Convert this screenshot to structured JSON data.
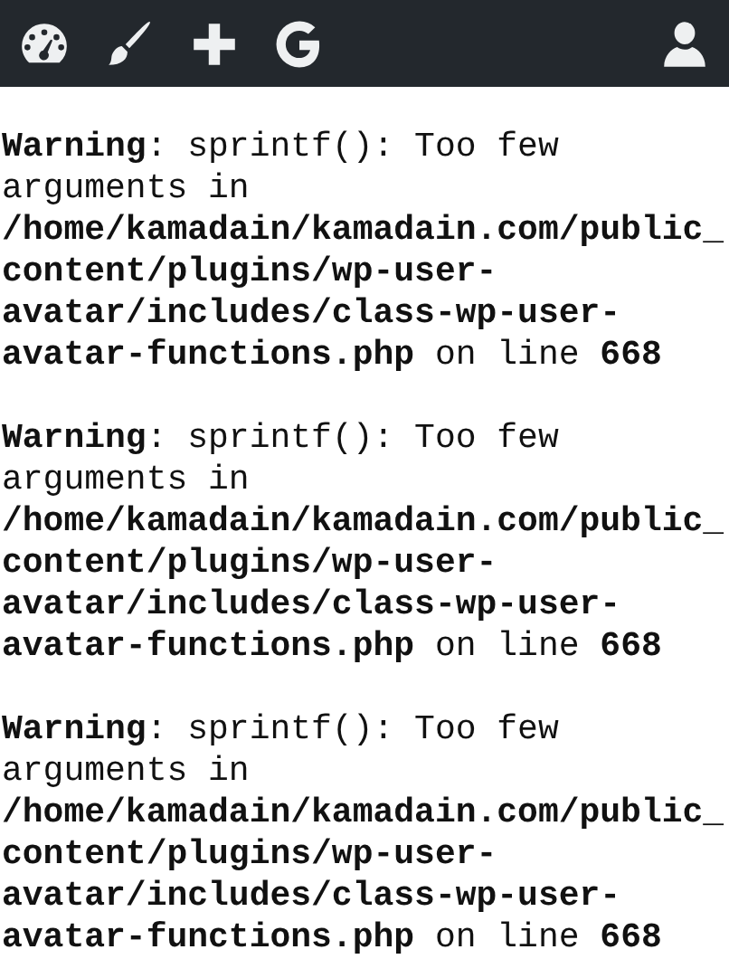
{
  "toolbar": {
    "items": [
      {
        "kind": "dashboard"
      },
      {
        "kind": "brush"
      },
      {
        "kind": "plus"
      },
      {
        "kind": "g"
      }
    ],
    "account": {
      "kind": "person"
    }
  },
  "warnings": [
    {
      "text": "**Warning**: sprintf(): Too few\narguments in\n**/home/kamadain/kamadain.com/public_**\n**content/plugins/wp-user-**\n**avatar/includes/class-wp-user-**\n**avatar-functions.php** on line **668**"
    },
    {
      "text": "**Warning**: sprintf(): Too few\narguments in\n**/home/kamadain/kamadain.com/public_**\n**content/plugins/wp-user-**\n**avatar/includes/class-wp-user-**\n**avatar-functions.php** on line **668**"
    },
    {
      "text": "**Warning**: sprintf(): Too few\narguments in\n**/home/kamadain/kamadain.com/public_**\n**content/plugins/wp-user-**\n**avatar/includes/class-wp-user-**\n**avatar-functions.php** on line **668**"
    }
  ]
}
